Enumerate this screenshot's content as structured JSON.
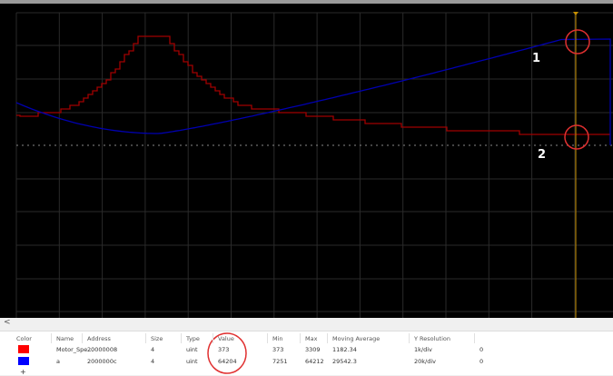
{
  "scroll_left_label": "<",
  "columns": [
    "Color",
    "Name",
    "Address",
    "Size",
    "Type",
    "Value",
    "Min",
    "Max",
    "Moving Average",
    "Y Resolution"
  ],
  "rows": [
    {
      "color": "#ff0000",
      "name": "Motor_Spe...",
      "address": "20000008",
      "size": "4",
      "type": "uint",
      "value": "373",
      "min": "373",
      "max": "3309",
      "moving_average": "1182.34",
      "y_resolution": "1k/div",
      "extra": "0"
    },
    {
      "color": "#0000ff",
      "name": "a",
      "address": "2000000c",
      "size": "4",
      "type": "uint",
      "value": "64204",
      "min": "7251",
      "max": "64212",
      "moving_average": "29542.3",
      "y_resolution": "20k/div",
      "extra": "0"
    }
  ],
  "add_label": "+",
  "annotations": [
    "1",
    "2"
  ],
  "colors": {
    "red_trace": "#a00000",
    "blue_trace": "#0000b0",
    "cursor": "#c89000",
    "highlight": "#e03030"
  }
}
